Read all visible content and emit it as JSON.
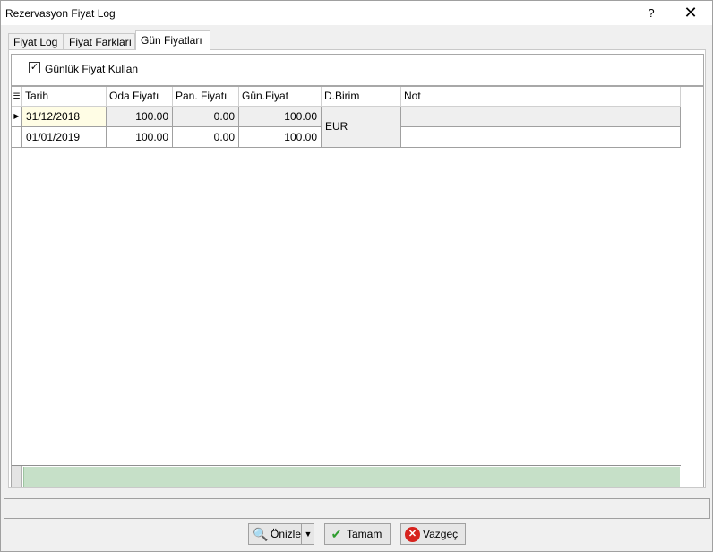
{
  "window": {
    "title": "Rezervasyon Fiyat Log",
    "help_symbol": "?",
    "close_symbol": "✕"
  },
  "tabs": [
    {
      "label": "Fiyat Log",
      "active": false
    },
    {
      "label": "Fiyat Farkları",
      "active": false
    },
    {
      "label": "Gün Fiyatları",
      "active": true
    }
  ],
  "checkbox": {
    "label": "Günlük Fiyat Kullan",
    "checked": true,
    "check_symbol": "✓"
  },
  "grid": {
    "indicator_icon": "columns-menu-icon",
    "indicator_symbol": "☰",
    "row_pointer_symbol": "▶",
    "columns": [
      "Tarih",
      "Oda Fiyatı",
      "Pan. Fiyatı",
      "Gün.Fiyat",
      "D.Birim",
      "Not"
    ],
    "rows": [
      {
        "tarih": "31/12/2018",
        "oda": "100.00",
        "pan": "0.00",
        "gun": "100.00",
        "not": "",
        "selected": true
      },
      {
        "tarih": "01/01/2019",
        "oda": "100.00",
        "pan": "0.00",
        "gun": "100.00",
        "not": "",
        "selected": false
      }
    ],
    "merged_currency": "EUR"
  },
  "buttons": {
    "preview": {
      "label": "Önizle",
      "icon": "preview-magnifier-icon",
      "icon_symbol": "🔍",
      "dropdown_symbol": "▼"
    },
    "ok": {
      "label": "Tamam",
      "icon": "checkmark-icon",
      "icon_symbol": "✔"
    },
    "cancel": {
      "label": "Vazgeç",
      "icon": "cancel-x-icon",
      "icon_symbol": "✕"
    }
  },
  "colors": {
    "footer_green": "#c6e0c8",
    "selected_cell": "#fffde5",
    "readonly_cell": "#efefef",
    "ok_icon": "#2e9d2e",
    "cancel_icon": "#d7231e"
  }
}
